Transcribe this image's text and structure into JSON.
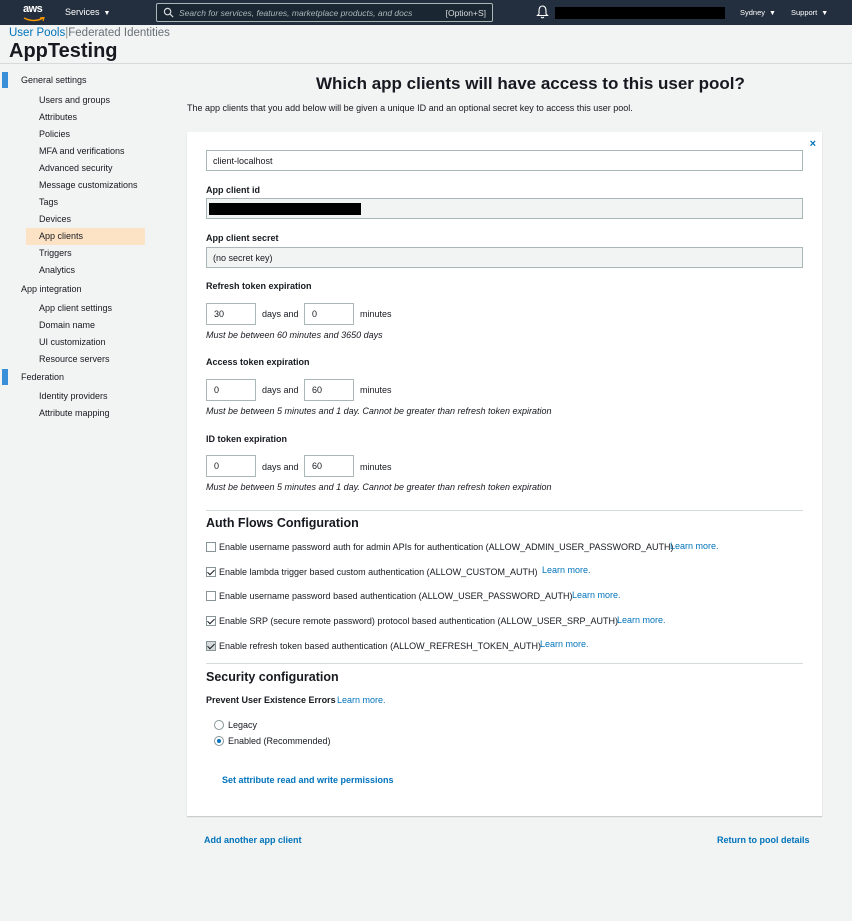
{
  "topnav": {
    "logo_text": "aws",
    "services_label": "Services",
    "search_placeholder": "Search for services, features, marketplace products, and docs",
    "search_shortcut": "[Option+S]",
    "region_label": "Sydney",
    "support_label": "Support"
  },
  "breadcrumb": {
    "user_pools": "User Pools",
    "separator": "|",
    "federated": "Federated Identities"
  },
  "pool_name": "AppTesting",
  "sidebar": {
    "sections": [
      {
        "label": "General settings"
      },
      {
        "label": "App integration"
      },
      {
        "label": "Federation"
      }
    ],
    "general_items": [
      "Users and groups",
      "Attributes",
      "Policies",
      "MFA and verifications",
      "Advanced security",
      "Message customizations",
      "Tags",
      "Devices",
      "App clients",
      "Triggers",
      "Analytics"
    ],
    "integration_items": [
      "App client settings",
      "Domain name",
      "UI customization",
      "Resource servers"
    ],
    "federation_items": [
      "Identity providers",
      "Attribute mapping"
    ]
  },
  "main": {
    "heading": "Which app clients will have access to this user pool?",
    "subtext": "The app clients that you add below will be given a unique ID and an optional secret key to access this user pool.",
    "close_icon": "×",
    "client_name": "client-localhost",
    "app_client_id_label": "App client id",
    "app_client_secret_label": "App client secret",
    "app_client_secret_value": "(no secret key)",
    "refresh": {
      "label": "Refresh token expiration",
      "days": "30",
      "minutes": "0",
      "hint": "Must be between 60 minutes and 3650 days"
    },
    "access": {
      "label": "Access token expiration",
      "days": "0",
      "minutes": "60",
      "hint": "Must be between 5 minutes and 1 day. Cannot be greater than refresh token expiration"
    },
    "idtoken": {
      "label": "ID token expiration",
      "days": "0",
      "minutes": "60",
      "hint": "Must be between 5 minutes and 1 day. Cannot be greater than refresh token expiration"
    },
    "days_and": "days and",
    "minutes_unit": "minutes",
    "auth_flows_heading": "Auth Flows Configuration",
    "auth_flows": [
      {
        "label": "Enable username password auth for admin APIs for authentication (ALLOW_ADMIN_USER_PASSWORD_AUTH)",
        "checked": false
      },
      {
        "label": "Enable lambda trigger based custom authentication (ALLOW_CUSTOM_AUTH)",
        "checked": true
      },
      {
        "label": "Enable username password based authentication (ALLOW_USER_PASSWORD_AUTH)",
        "checked": false
      },
      {
        "label": "Enable SRP (secure remote password) protocol based authentication (ALLOW_USER_SRP_AUTH)",
        "checked": true
      },
      {
        "label": "Enable refresh token based authentication (ALLOW_REFRESH_TOKEN_AUTH)",
        "checked": true
      }
    ],
    "learn_more": "Learn more.",
    "security_heading": "Security configuration",
    "prevent_label": "Prevent User Existence Errors",
    "radio_legacy": "Legacy",
    "radio_enabled": "Enabled (Recommended)",
    "set_attr_link": "Set attribute read and write permissions",
    "add_client_link": "Add another app client",
    "return_link": "Return to pool details"
  },
  "colors": {
    "nav_bg": "#232f3e",
    "link": "#0073bb",
    "active_bg": "#fde3c6",
    "section_bar": "#3a8fd9"
  }
}
